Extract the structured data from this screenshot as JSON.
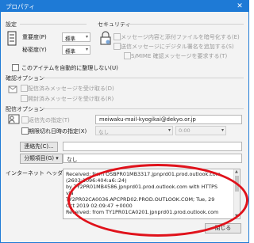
{
  "titlebar": {
    "title": "プロパティ",
    "close": "✕"
  },
  "settings": {
    "header": "設定",
    "importance_label": "重要度(P)",
    "importance_value": "標準",
    "sensitivity_label": "秘密度(Y)",
    "sensitivity_value": "標準",
    "no_archive_label": "このアイテムを自動的に整理しない(U)"
  },
  "security": {
    "header": "セキュリティ",
    "encrypt_label": "メッセージ内容と添付ファイルを暗号化する(E)",
    "signature_label": "送信メッセージにデジタル署名を追加する(S)",
    "smime_label": "S/MIME 確認メッセージを要求する(T)"
  },
  "tracking": {
    "header": "確認オプション",
    "delivery_label": "配信済みメッセージを受け取る(D)",
    "read_label": "開封済みメッセージを受け取る(R)"
  },
  "delivery": {
    "header": "配信オプション",
    "reply_label": "返信先の指定(T)",
    "reply_value": "meiwaku-mail-kyogikai@dekyo.or.jp",
    "expire_label": "期限切れ日時の指定(X)",
    "expire_date": "なし",
    "expire_time": "0:00"
  },
  "contacts_button": "連絡先(C)...",
  "categories": {
    "button": "分類項目(G)",
    "value": "なし"
  },
  "headers": {
    "label": "インターネット ヘッダー(H)",
    "lines": [
      "Received: from OSBPR01MB3317.jpnprd01.prod.outlook.com",
      "(2603:1096:404:a6::24)",
      "by TY2PR01MB4586.jpnprd01.prod.outlook.com with HTTPS",
      "via",
      "TY2PR02CA0036.APCPRD02.PROD.OUTLOOK.COM; Tue, 29",
      "Oct 2019 02:09:47 +0000",
      "Received: from TY1PR01CA0201.jpnprd01.prod.outlook.com"
    ]
  },
  "close_button": "閉じる",
  "colors": {
    "titlebar": "#1e7ad6",
    "annotation": "#e0121b"
  }
}
